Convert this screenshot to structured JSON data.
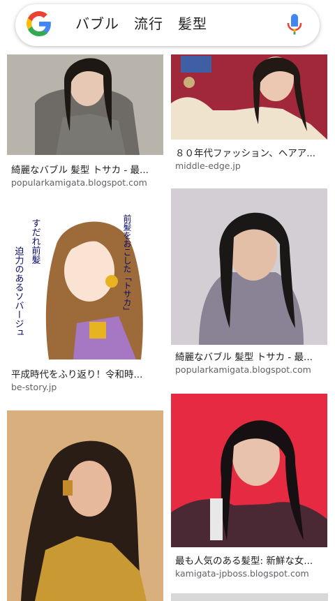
{
  "search": {
    "query": "バブル　流行　髪型",
    "logo_icon": "google-g-icon",
    "mic_icon": "microphone-icon"
  },
  "results": [
    {
      "title": "綺麗なバブル 髪型 トサカ - 最...",
      "source": "popularkamigata.blogspot.com"
    },
    {
      "title": "８０年代ファッション、ヘアア...",
      "source": "middle-edge.jp"
    },
    {
      "title": "平成時代をふり返り！令和時...",
      "source": "be-story.jp"
    },
    {
      "title": "綺麗なバブル 髪型 トサカ - 最...",
      "source": "popularkamigata.blogspot.com"
    },
    {
      "title": "",
      "source": ""
    },
    {
      "title": "最も人気のある髪型: 新鮮な女...",
      "source": "kamigata-jpboss.blogspot.com"
    }
  ],
  "illustration_text": {
    "left": "すだれ前髪",
    "top_right": "前髪をおこした「トサカ」",
    "bottom_right": "迫力のあるソバージュ"
  },
  "colors": {
    "google_blue": "#4285F4",
    "google_red": "#EA4335",
    "google_yellow": "#FBBC05",
    "google_green": "#34A853"
  }
}
